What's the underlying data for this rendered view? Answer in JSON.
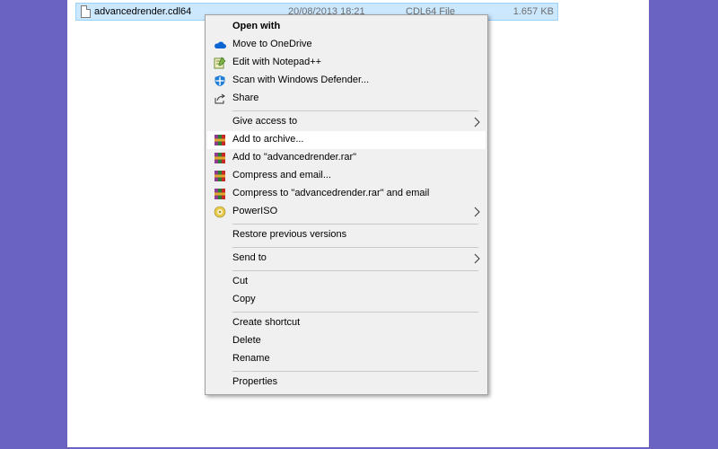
{
  "file": {
    "name": "advancedrender.cdl64",
    "date_modified": "20/08/2013 18:21",
    "type": "CDL64 File",
    "size": "1.657 KB"
  },
  "context_menu": {
    "open_with": "Open with",
    "move_to_onedrive": "Move to OneDrive",
    "edit_notepad": "Edit with Notepad++",
    "scan_defender": "Scan with Windows Defender...",
    "share": "Share",
    "give_access": "Give access to",
    "add_to_archive": "Add to archive...",
    "add_to_rar": "Add to \"advancedrender.rar\"",
    "compress_email": "Compress and email...",
    "compress_rar_email": "Compress to \"advancedrender.rar\" and email",
    "poweriso": "PowerISO",
    "restore_versions": "Restore previous versions",
    "send_to": "Send to",
    "cut": "Cut",
    "copy": "Copy",
    "create_shortcut": "Create shortcut",
    "delete": "Delete",
    "rename": "Rename",
    "properties": "Properties"
  },
  "icons": {
    "onedrive": "onedrive-cloud-icon",
    "notepad": "notepad-plus-plus-icon",
    "defender": "windows-defender-icon",
    "share": "share-icon",
    "winrar": "winrar-books-icon",
    "poweriso": "poweriso-disc-icon",
    "submenu": "chevron-right-icon"
  },
  "colors": {
    "desktop_background": "#6b63c1",
    "selection": "#cce8ff",
    "menu_background": "#f0f0f0",
    "hover": "#ffffff"
  }
}
